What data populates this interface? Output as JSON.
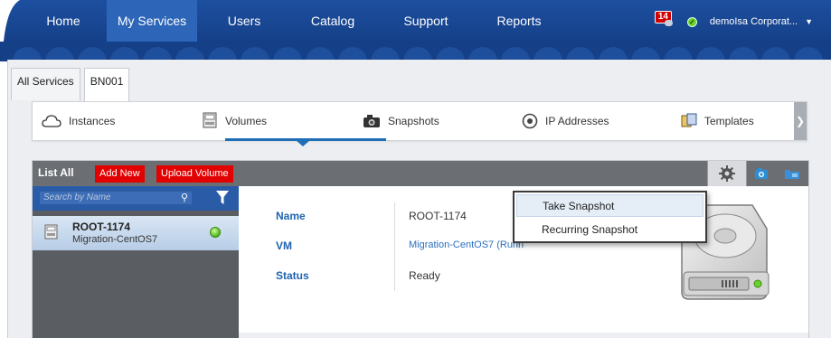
{
  "nav": {
    "items": [
      "Home",
      "My Services",
      "Users",
      "Catalog",
      "Support",
      "Reports"
    ],
    "active": "My Services",
    "notification_count": "14",
    "account": "demoIsa Corporat..."
  },
  "tabs": [
    "All Services",
    "BN001"
  ],
  "subnav": [
    "Instances",
    "Volumes",
    "Snapshots",
    "IP Addresses",
    "Templates"
  ],
  "toolbar": {
    "title": "List All",
    "add_new": "Add New",
    "upload_volume": "Upload Volume"
  },
  "search": {
    "placeholder": "Search by Name"
  },
  "list": [
    {
      "name": "ROOT-1174",
      "sub": "Migration-CentOS7"
    }
  ],
  "details": {
    "name_label": "Name",
    "name_value": "ROOT-1174",
    "vm_label": "VM",
    "vm_value": "Migration-CentOS7 (Runn",
    "status_label": "Status",
    "status_value": "Ready"
  },
  "context_menu": [
    "Take Snapshot",
    "Recurring Snapshot"
  ],
  "colors": {
    "nav": "#1d4fa0",
    "accent": "#1f6fb6",
    "red": "#e30000"
  }
}
